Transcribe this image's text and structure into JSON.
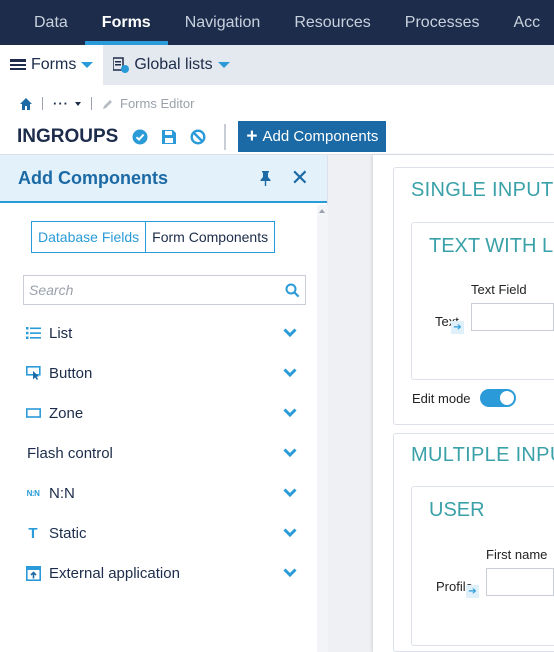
{
  "topnav": {
    "tabs": [
      {
        "label": "Data"
      },
      {
        "label": "Forms",
        "active": true
      },
      {
        "label": "Navigation"
      },
      {
        "label": "Resources"
      },
      {
        "label": "Processes"
      },
      {
        "label": "Acc"
      }
    ]
  },
  "subnav": {
    "forms_label": "Forms",
    "global_lists_label": "Global lists"
  },
  "breadcrumb": {
    "dots": "···",
    "editor_label": "Forms Editor"
  },
  "header": {
    "title": "INGROUPS",
    "add_button": "Add Components"
  },
  "panel": {
    "title": "Add Components",
    "toggle": {
      "database_fields": "Database Fields",
      "form_components": "Form Components"
    },
    "search_placeholder": "Search",
    "components": [
      {
        "label": "List",
        "icon": "list-icon"
      },
      {
        "label": "Button",
        "icon": "button-icon"
      },
      {
        "label": "Zone",
        "icon": "zone-icon"
      },
      {
        "label": "Flash control",
        "icon": ""
      },
      {
        "label": "N:N",
        "icon": "nn-icon",
        "icon_text": "N:N"
      },
      {
        "label": "Static",
        "icon": "static-icon",
        "icon_text": "T"
      },
      {
        "label": "External application",
        "icon": "external-app-icon"
      }
    ]
  },
  "canvas": {
    "single_input": {
      "title": "SINGLE INPUT",
      "sub_title": "TEXT WITH L",
      "field_label": "Text Field",
      "side_label": "Text",
      "edit_mode_label": "Edit mode",
      "edit_mode_on": true
    },
    "multiple_input": {
      "title": "MULTIPLE INPU",
      "sub_title": "USER",
      "field_label": "First name",
      "side_label": "Profile"
    }
  },
  "colors": {
    "nav_bg": "#1c2c4a",
    "accent": "#2a9bd8",
    "primary_button": "#1b6aa5",
    "section_title": "#3aa1a9"
  }
}
